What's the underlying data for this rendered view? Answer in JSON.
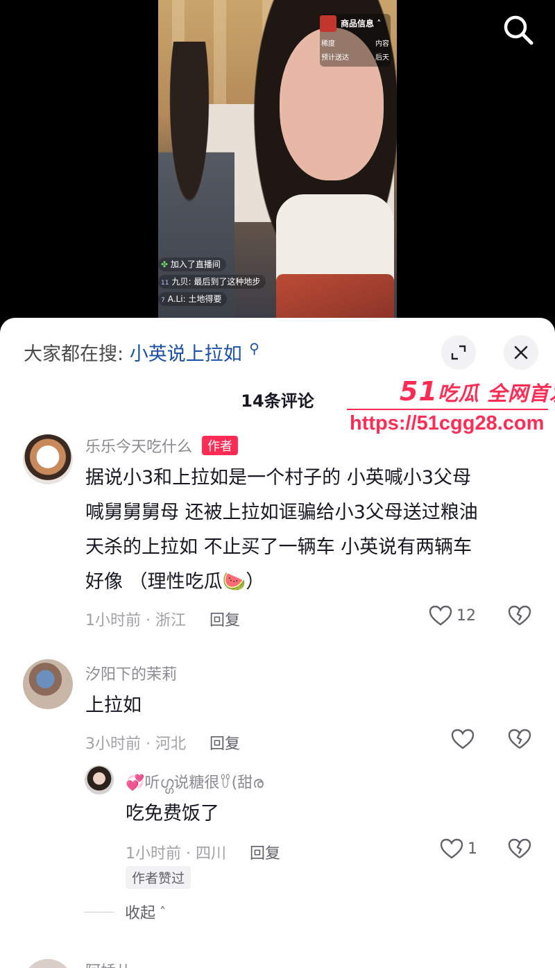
{
  "live": {
    "product_card": {
      "title": "商品信息",
      "left_1": "稀度",
      "right_1": "内容",
      "left_2": "预计送达",
      "right_2": "后天"
    },
    "chat": [
      {
        "level": "",
        "user": "",
        "text": "加入了直播间"
      },
      {
        "level": "11",
        "user": "九贝:",
        "text": "最后到了这种地步"
      },
      {
        "level": "7",
        "user": "A.Li:",
        "text": "土地得要"
      }
    ]
  },
  "sheet": {
    "hot_search_label": "大家都在搜:",
    "hot_search_keyword": "小英说上拉如",
    "comment_count": "14条评论"
  },
  "watermark": {
    "brand_num": "51",
    "brand_text": "吃瓜 全网首发",
    "url": "https://51cgg28.com"
  },
  "comments": [
    {
      "user": "乐乐今天吃什么",
      "badge": "作者",
      "text_lines": [
        "据说小3和上拉如是一个村子的 小英喊小3父母",
        "喊舅舅舅母 还被上拉如诓骗给小3父母送过粮油",
        "天杀的上拉如 不止买了一辆车 小英说有两辆车",
        "好像 （理性吃瓜🍉）"
      ],
      "meta": "1小时前 · 浙江",
      "reply_label": "回复",
      "likes": "12"
    },
    {
      "user": "汐阳下的茉莉",
      "text": "上拉如",
      "meta": "3小时前 · 河北",
      "reply_label": "回复",
      "likes": ""
    },
    {
      "user": "💞听ഗ്ഗ说糖很ꀎ(甜ര",
      "text": "吃免费饭了",
      "meta": "1小时前 · 四川",
      "reply_label": "回复",
      "likes": "1",
      "author_liked": "作者赞过"
    }
  ],
  "collapse_label": "收起",
  "next_user_partial": "阿娇儿"
}
